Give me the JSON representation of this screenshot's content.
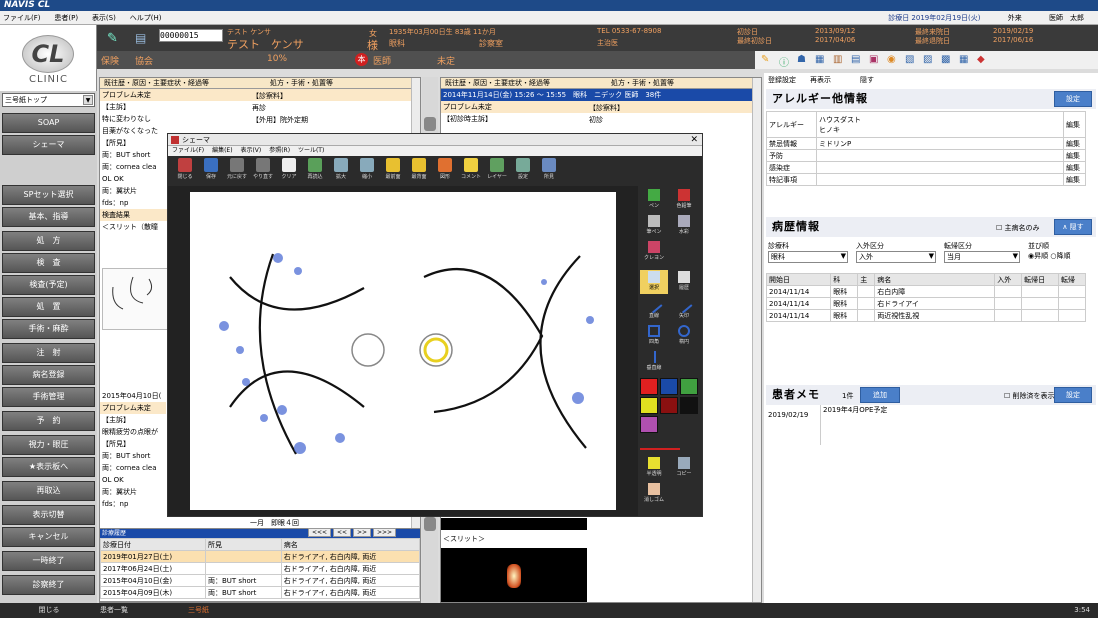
{
  "app_title": "NAVIS CL",
  "menu": [
    "ファイル(F)",
    "患者(P)",
    "表示(S)",
    "ヘルプ(H)"
  ],
  "menu_right": {
    "date": "診療日 2019年02月19日(火)",
    "type": "外来",
    "doctor": "医師　太郎"
  },
  "logo": {
    "text": "CL",
    "sub": "CLINIC"
  },
  "patient": {
    "id": "00000015",
    "kana": "テスト ケンサ",
    "name": "テスト　ケンサ",
    "sex": "女",
    "honorific": "様",
    "birth": "1935年03月00日生 83歳 11か月",
    "dept": "眼科",
    "room": "診察室",
    "tel": "TEL 0533-67-8908",
    "attending": "主治医",
    "first_visit_label": "初診日",
    "first_visit": "2013/09/12",
    "last_first_label": "最終初診日",
    "last_first": "2017/04/06",
    "last_visit_label": "最終来院日",
    "last_visit": "2019/02/19",
    "last_return_label": "最終退院日",
    "last_return": "2017/06/16"
  },
  "insurance": {
    "label": "保険",
    "value": "協会",
    "rate": "10%",
    "badge": "本",
    "doctor_label": "医師",
    "doctor": "未定"
  },
  "sidebar": {
    "dropdown": "三号紙トップ",
    "buttons": [
      "SOAP",
      "シェーマ",
      "SPセット選択",
      "基本、指導",
      "処　方",
      "検　査",
      "検査(予定)",
      "処　置",
      "手術・麻酔",
      "注　射",
      "病名登録",
      "手術管理",
      "予　約",
      "視力・眼圧",
      "★表示板へ",
      "再取込",
      "表示切替",
      "キャンセル",
      "一時終了",
      "診察終了"
    ]
  },
  "history": {
    "col1": "既往歴・原因・主要症状・経過等",
    "col2": "処方・手術・処置等",
    "left_rows": [
      "プロブレム未定",
      "【主訴】",
      "特に変わりなし",
      "目薬がなくなった",
      "【所見】",
      "両：BUT short",
      "両：cornea clea",
      "OL OK",
      "両：翼状片",
      "fds：np",
      "検査結果",
      "＜スリット（散瞳"
    ],
    "left_rows2": [
      "2015年04月10日(",
      "プロブレム未定",
      "【主訴】",
      "眼精疲労の点眼が",
      "【所見】",
      "両：BUT short",
      "両：cornea clea",
      "OL OK",
      "両：翼状片",
      "fds：np"
    ],
    "right_rows": [
      "【診察料】",
      "再診",
      "【外用】院外定期"
    ],
    "second": {
      "header": "2014年11月14日(金) 15:26 〜 15:55　眼科　ニデック 医師　38件",
      "rows": [
        "プロブレム未定",
        "【初診時主訴】"
      ],
      "right_rows": [
        "【診察料】",
        "初診"
      ],
      "slit_label": "＜スリット＞"
    }
  },
  "schema": {
    "title": "シェーマ",
    "menu": [
      "ファイル(F)",
      "編集(E)",
      "表示(V)",
      "参照(R)",
      "ツール(T)"
    ],
    "tools": [
      "閉じる",
      "保存",
      "元に戻す",
      "やり直す",
      "クリア",
      "再読込",
      "拡大",
      "縮小",
      "最前面",
      "最背面",
      "図形",
      "コメント",
      "レイヤー",
      "設定",
      "所見"
    ],
    "palette": [
      "ペン",
      "色鉛筆",
      "筆ペン",
      "水彩",
      "クレヨン",
      "選択",
      "履歴",
      "直線",
      "矢印",
      "四角",
      "楕円",
      "垂直線",
      "半透明",
      "コピー",
      "消しゴム"
    ],
    "colors": [
      "#e02020",
      "#1a4aa8",
      "#40a040",
      "#e0e020",
      "#8a1010",
      "#111111",
      "#b050b0"
    ]
  },
  "diagnosis_history": {
    "title": "診療履歴",
    "cols": [
      "診療日付",
      "所見",
      "病名"
    ],
    "rows": [
      [
        "2019年01月27日(土)",
        "",
        "右ドライアイ, 右白内障, 両近"
      ],
      [
        "2017年06月24日(土)",
        "",
        "右ドライアイ, 右白内障, 両近"
      ],
      [
        "2015年04月10日(金)",
        "両：BUT short",
        "右ドライアイ, 右白内障, 両近"
      ],
      [
        "2015年04月09日(木)",
        "両：BUT short",
        "右ドライアイ, 右白内障, 両近"
      ]
    ],
    "pager": [
      "<<<",
      "<<",
      ">>",
      ">>>"
    ],
    "extra": "一月　即眼４回"
  },
  "right_panel": {
    "tabs": [
      "登録設定",
      "再表示",
      "隠す"
    ],
    "allergy": {
      "title": "アレルギー他情報",
      "set_btn": "設定",
      "rows": [
        {
          "label": "アレルギー",
          "value": "ハウスダスト\nヒノキ",
          "btn": "編集"
        },
        {
          "label": "禁忌情報",
          "value": "ミドリンP",
          "btn": "編集"
        },
        {
          "label": "予防",
          "value": "",
          "btn": "編集"
        },
        {
          "label": "感染症",
          "value": "",
          "btn": "編集"
        },
        {
          "label": "特記事項",
          "value": "",
          "btn": "編集"
        }
      ]
    },
    "disease": {
      "title": "病歴情報",
      "main_only": "主病名のみ",
      "hide_btn": "∧ 隠す",
      "filters": [
        {
          "label": "診療科",
          "value": "眼科"
        },
        {
          "label": "入外区分",
          "value": "入外"
        },
        {
          "label": "転帰区分",
          "value": "当月"
        }
      ],
      "order_label": "並び順",
      "order": [
        "昇順",
        "降順"
      ],
      "cols": [
        "開始日",
        "科",
        "主",
        "病名",
        "入外",
        "転帰日",
        "転帰"
      ],
      "rows": [
        [
          "2014/11/14",
          "眼科",
          "",
          "右白内障",
          "",
          "",
          ""
        ],
        [
          "2014/11/14",
          "眼科",
          "",
          "右ドライアイ",
          "",
          "",
          ""
        ],
        [
          "2014/11/14",
          "眼科",
          "",
          "両近視性乱視",
          "",
          "",
          ""
        ]
      ]
    },
    "memo": {
      "title": "患者メモ",
      "count": "1件",
      "add_btn": "追加",
      "show_deleted": "削除済を表示",
      "set_btn": "設定",
      "date": "2019/02/19",
      "text": "2019年4月OPE予定"
    }
  },
  "statusbar": {
    "close": "閉じる",
    "tab1": "患者一覧",
    "tab2": "三号紙",
    "time": "3:54"
  }
}
